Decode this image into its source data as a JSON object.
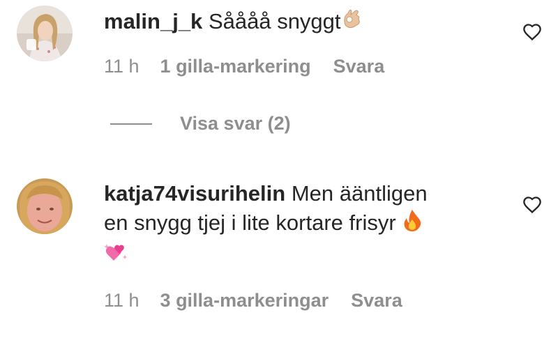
{
  "comments": [
    {
      "username": "malin_j_k",
      "text": "Såååå snyggt",
      "emoji": "ok-hand",
      "time": "11 h",
      "likes": "1 gilla-markering",
      "reply": "Svara"
    },
    {
      "username": "katja74visurihelin",
      "text_line1": "Men ääntligen",
      "text_line2": "en snygg tjej i lite kortare frisyr",
      "emoji_fire": "fire",
      "emoji_heart": "sparkling-heart",
      "time": "11 h",
      "likes": "3 gilla-markeringar",
      "reply": "Svara"
    }
  ],
  "view_replies": "Visa svar (2)",
  "colors": {
    "text": "#262626",
    "secondary": "#8e8e8e",
    "background": "#ffffff"
  }
}
